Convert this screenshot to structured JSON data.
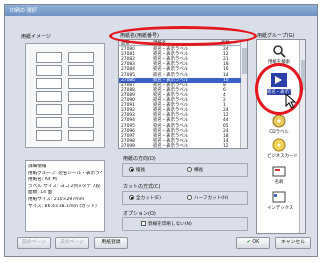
{
  "window": {
    "title": "印刷の 選択"
  },
  "preview_pane": {
    "label": "用紙イメージ"
  },
  "description": {
    "label": "詳細情報",
    "lines": [
      "用紙グループ: 宛名シール・表示ラベル",
      "用紙名: A4 判",
      "ラベル サイズ: ヨコ 2列×タテ 7段",
      "面数: 14 面",
      "用紙サイズ: 210×297mm",
      "サイズ: 86.4×38.1mm (カット)"
    ]
  },
  "paper_list": {
    "label": "用紙名(用紙番号)",
    "headers": [
      "品番",
      "用紙名",
      "面数"
    ],
    "rows": [
      [
        "27080",
        "宛名・表示ラベル",
        "24"
      ],
      [
        "27081",
        "宛名・表示ラベル",
        "12"
      ],
      [
        "27082",
        "宛名・表示ラベル",
        "21"
      ],
      [
        "27083",
        "宛名・表示ラベル",
        "18"
      ],
      [
        "27084",
        "宛名・表示ラベル",
        "16"
      ],
      [
        "27085",
        "宛名・表示ラベル",
        "14"
      ],
      [
        "27086",
        "宛名・表示ラベル",
        "10"
      ],
      [
        "27087",
        "宛名・表示ラベル",
        "8"
      ],
      [
        "27088",
        "宛名・表示ラベル",
        "6"
      ],
      [
        "27089",
        "宛名・表示ラベル",
        "4"
      ],
      [
        "27090",
        "宛名・表示ラベル",
        "2"
      ],
      [
        "27091",
        "宛名・表示ラベル",
        "1"
      ],
      [
        "27092",
        "宛名・表示ラベル",
        "24"
      ],
      [
        "27093",
        "宛名・表示ラベル",
        "12"
      ],
      [
        "27094",
        "宛名・表示ラベル",
        "44"
      ],
      [
        "27095",
        "宛名・表示ラベル",
        "65"
      ],
      [
        "27096",
        "宛名・表示ラベル",
        "24"
      ],
      [
        "27097",
        "宛名・表示ラベル",
        "18"
      ],
      [
        "27098",
        "宛名・表示ラベル",
        "14"
      ],
      [
        "27099",
        "宛名・表示ラベル",
        "12"
      ]
    ],
    "selected_index": 6
  },
  "orientation": {
    "label": "用紙の方向(D)",
    "options": [
      "縦長",
      "横長"
    ],
    "selected": 0
  },
  "cut": {
    "label": "カットの方式(C)",
    "options": [
      "全カット(E)",
      "ハーフカット(H)"
    ],
    "selected": 0
  },
  "options": {
    "label": "オプション(O)",
    "checkbox": "罫線を印刷しない(N)"
  },
  "group_panel": {
    "label": "用紙グループ(G)",
    "items": [
      {
        "icon": "search-icon",
        "label": "用紙を検索"
      },
      {
        "icon": "label-icon",
        "label": "宛名・表示ラベル"
      },
      {
        "icon": "cd-icon",
        "label": "CDラベル"
      },
      {
        "icon": "business-card-icon",
        "label": "ビジネスカード"
      },
      {
        "icon": "postcard-icon",
        "label": "名刺"
      },
      {
        "icon": "index-icon",
        "label": "インデックス"
      }
    ]
  },
  "buttons": {
    "prev": "前のページ",
    "next": "次のページ",
    "memo": "用紙登録",
    "ok": "OK",
    "cancel": "キャンセル"
  },
  "colors": {
    "highlight_ring": "#e5161d",
    "window_bg": "#d9dee8"
  }
}
